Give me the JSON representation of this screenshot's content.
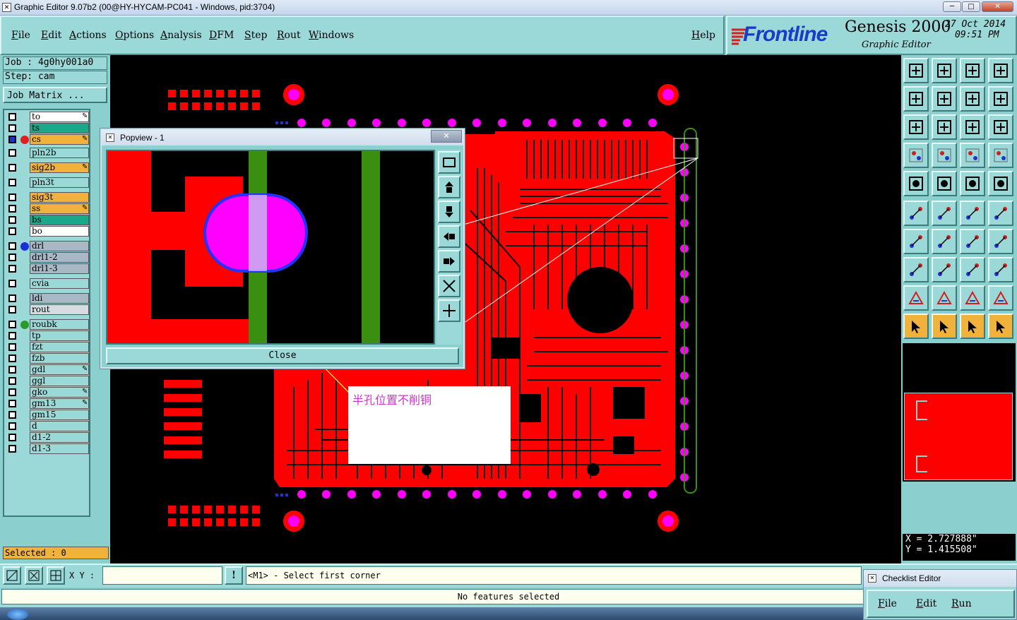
{
  "window": {
    "title": "Graphic Editor 9.07b2 (00@HY-HYCAM-PC041 - Windows, pid:3704)",
    "minimize": "─",
    "maximize": "□",
    "close": "✕"
  },
  "menu": {
    "items": [
      "File",
      "Edit",
      "Actions",
      "Options",
      "Analysis",
      "DFM",
      "Step",
      "Rout",
      "Windows"
    ],
    "help": "Help"
  },
  "brand": {
    "logo": "Frontline",
    "product": "Genesis 2000",
    "subtitle": "Graphic Editor",
    "date": "27 Oct 2014",
    "time": "09:51 PM"
  },
  "job": {
    "job_line": "Job : 4g0hy001a0",
    "step_line": "Step: cam",
    "matrix_button": "Job Matrix ..."
  },
  "layers": [
    {
      "name": "to",
      "color": "#ffffff",
      "edit": true,
      "dot": null
    },
    {
      "name": "ts",
      "color": "#1aa88a",
      "edit": false,
      "dot": null
    },
    {
      "name": "cs",
      "color": "#f0b23a",
      "edit": true,
      "dot": "#e02020",
      "active": true
    },
    {
      "name": "pln2b",
      "color": "#9bd9d9",
      "edit": false,
      "dot": null
    },
    {
      "name": "sig2b",
      "color": "#f0b23a",
      "edit": true,
      "dot": null
    },
    {
      "name": "pln3t",
      "color": "#9bd9d9",
      "edit": false,
      "dot": null
    },
    {
      "name": "sig3t",
      "color": "#f0b23a",
      "edit": false,
      "dot": null
    },
    {
      "name": "ss",
      "color": "#f0b23a",
      "edit": true,
      "dot": null
    },
    {
      "name": "bs",
      "color": "#1aa88a",
      "edit": false,
      "dot": null
    },
    {
      "name": "bo",
      "color": "#ffffff",
      "edit": false,
      "dot": null
    },
    {
      "name": "drl",
      "color": "#a8b8c4",
      "edit": false,
      "dot": "#1a2fd6"
    },
    {
      "name": "drl1-2",
      "color": "#a8b8c4",
      "edit": false,
      "dot": null
    },
    {
      "name": "drl1-3",
      "color": "#a8b8c4",
      "edit": false,
      "dot": null
    },
    {
      "name": "cvia",
      "color": "#9bd9d9",
      "edit": false,
      "dot": null
    },
    {
      "name": "ldi",
      "color": "#a8b8c4",
      "edit": false,
      "dot": null
    },
    {
      "name": "rout",
      "color": "#d6dde2",
      "edit": false,
      "dot": null
    },
    {
      "name": "roubk",
      "color": "#9bd9d9",
      "edit": false,
      "dot": "#2a9a2a"
    },
    {
      "name": "tp",
      "color": "#9bd9d9",
      "edit": false,
      "dot": null
    },
    {
      "name": "fzt",
      "color": "#9bd9d9",
      "edit": false,
      "dot": null
    },
    {
      "name": "fzb",
      "color": "#9bd9d9",
      "edit": false,
      "dot": null
    },
    {
      "name": "gdl",
      "color": "#9bd9d9",
      "edit": true,
      "dot": null
    },
    {
      "name": "ggl",
      "color": "#9bd9d9",
      "edit": false,
      "dot": null
    },
    {
      "name": "gko",
      "color": "#9bd9d9",
      "edit": true,
      "dot": null
    },
    {
      "name": "gm13",
      "color": "#9bd9d9",
      "edit": true,
      "dot": null
    },
    {
      "name": "gm15",
      "color": "#9bd9d9",
      "edit": false,
      "dot": null
    },
    {
      "name": "d",
      "color": "#9bd9d9",
      "edit": false,
      "dot": null
    },
    {
      "name": "d1-2",
      "color": "#9bd9d9",
      "edit": false,
      "dot": null
    },
    {
      "name": "d1-3",
      "color": "#9bd9d9",
      "edit": false,
      "dot": null
    }
  ],
  "selected": "Selected : 0",
  "popview": {
    "title": "Popview - 1",
    "close_button": "Close",
    "close_x": "✕"
  },
  "annotation": {
    "text": "半孔位置不削铜",
    "color": "#cc33cc"
  },
  "coords": {
    "x": "X = 2.727888\"",
    "y": "Y = 1.415508\""
  },
  "bottom": {
    "xy_label": "X Y :",
    "xy_value": "",
    "prompt": "<M1> - Select first corner",
    "status": "No features selected"
  },
  "checklist": {
    "title": "Checklist Editor",
    "menu": [
      "File",
      "Edit",
      "Run"
    ]
  },
  "colors": {
    "copper": "#ff0000",
    "pad": "#ff00ff",
    "rout": "#3a8f10",
    "panel": "#9bd9d9"
  }
}
